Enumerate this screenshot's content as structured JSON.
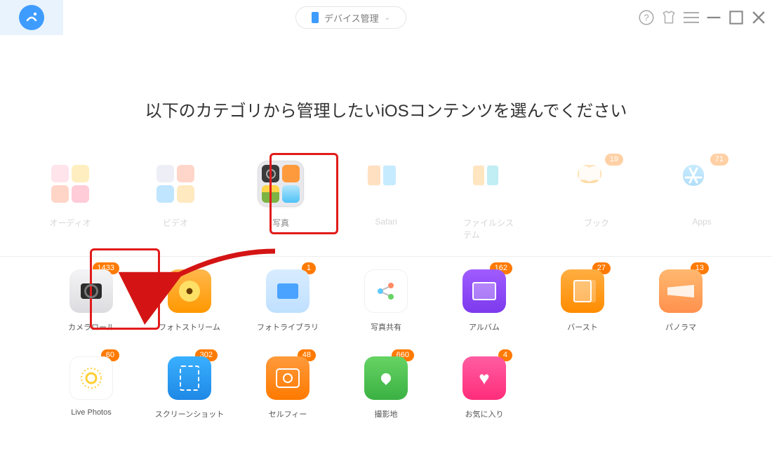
{
  "header": {
    "device_label": "デバイス管理"
  },
  "heading": "以下のカテゴリから管理したいiOSコンテンツを選んでください",
  "top_categories": [
    {
      "label": "オーディオ",
      "badge": null
    },
    {
      "label": "ビデオ",
      "badge": null
    },
    {
      "label": "写真",
      "badge": null
    },
    {
      "label": "Safari",
      "badge": null
    },
    {
      "label": "ファイルシステム",
      "badge": null
    },
    {
      "label": "ブック",
      "badge": "19"
    },
    {
      "label": "Apps",
      "badge": "71"
    }
  ],
  "photo_subcategories_row1": [
    {
      "label": "カメラロール",
      "badge": "1433",
      "icon": "ic-cameraroll"
    },
    {
      "label": "フォトストリーム",
      "badge": null,
      "icon": "ic-stream"
    },
    {
      "label": "フォトライブラリ",
      "badge": "1",
      "icon": "ic-lib"
    },
    {
      "label": "写真共有",
      "badge": null,
      "icon": "ic-share"
    },
    {
      "label": "アルバム",
      "badge": "162",
      "icon": "ic-album"
    },
    {
      "label": "バースト",
      "badge": "27",
      "icon": "ic-burst"
    },
    {
      "label": "パノラマ",
      "badge": "13",
      "icon": "ic-pano"
    }
  ],
  "photo_subcategories_row2": [
    {
      "label": "Live Photos",
      "badge": "60",
      "icon": "ic-live"
    },
    {
      "label": "スクリーンショット",
      "badge": "302",
      "icon": "ic-shot"
    },
    {
      "label": "セルフィー",
      "badge": "48",
      "icon": "ic-selfie"
    },
    {
      "label": "撮影地",
      "badge": "660",
      "icon": "ic-place"
    },
    {
      "label": "お気に入り",
      "badge": "4",
      "icon": "ic-fav"
    }
  ]
}
